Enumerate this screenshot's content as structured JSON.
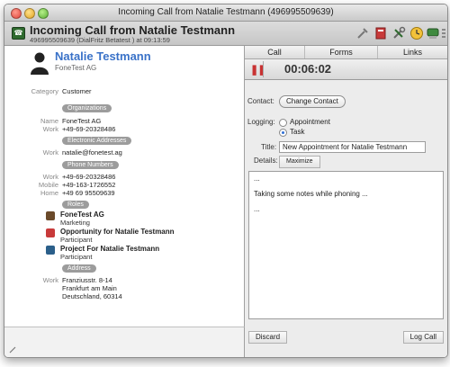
{
  "window": {
    "title": "Incoming Call from Natalie Testmann (496995509639)"
  },
  "header": {
    "title": "Incoming Call from Natalie Testmann",
    "subtitle": "496995509639 (DialFritz Betatest ) at 09:13:59",
    "icons": [
      "tools-icon",
      "contact-card-icon",
      "wrench-icon",
      "clock-icon",
      "phone-icon",
      "list-icon"
    ]
  },
  "contact": {
    "name": "Natalie Testmann",
    "company": "FoneTest AG",
    "category_label": "Category",
    "category_value": "Customer",
    "sections": {
      "organizations": "Organizations",
      "electronic": "Electronic Addresses",
      "phones": "Phone Numbers",
      "roles": "Roles",
      "address": "Address"
    },
    "organization": {
      "label": "Name",
      "name": "FoneTest AG",
      "work_label": "Work",
      "work": "+49-69-20328486"
    },
    "email": {
      "label": "Work",
      "value": "natalie@fonetest.ag"
    },
    "phones": [
      {
        "label": "Work",
        "value": "+49-69-20328486"
      },
      {
        "label": "Mobile",
        "value": "+49-163-1726552"
      },
      {
        "label": "Home",
        "value": "+49 69 95509639"
      }
    ],
    "roles": [
      {
        "name": "FoneTest AG",
        "role": "Marketing",
        "color": "#6b4a2a"
      },
      {
        "name": "Opportunity for Natalie Testmann",
        "role": "Participant",
        "color": "#c83a3a"
      },
      {
        "name": "Project For Natalie Testmann",
        "role": "Participant",
        "color": "#2b5f8a"
      }
    ],
    "address": {
      "label": "Work",
      "lines": [
        "Franziusstr. 8-14",
        "Frankfurt am Main",
        "Deutschland, 60314"
      ]
    }
  },
  "tabs": [
    "Call",
    "Forms",
    "Links"
  ],
  "timer": "00:06:02",
  "form": {
    "contact_label": "Contact:",
    "change_contact": "Change Contact",
    "logging_label": "Logging:",
    "appointment": "Appointment",
    "task": "Task",
    "title_label": "Title:",
    "title_value": "New Appointment for Natalie Testmann",
    "details_label": "Details:",
    "maximize": "Maximize",
    "notes": [
      "...",
      "Taking some notes while phoning ...",
      "..."
    ]
  },
  "bottom": {
    "discard": "Discard",
    "log_call": "Log Call"
  },
  "colors": {
    "accent": "#3a72c8",
    "pause": "#c83232"
  }
}
